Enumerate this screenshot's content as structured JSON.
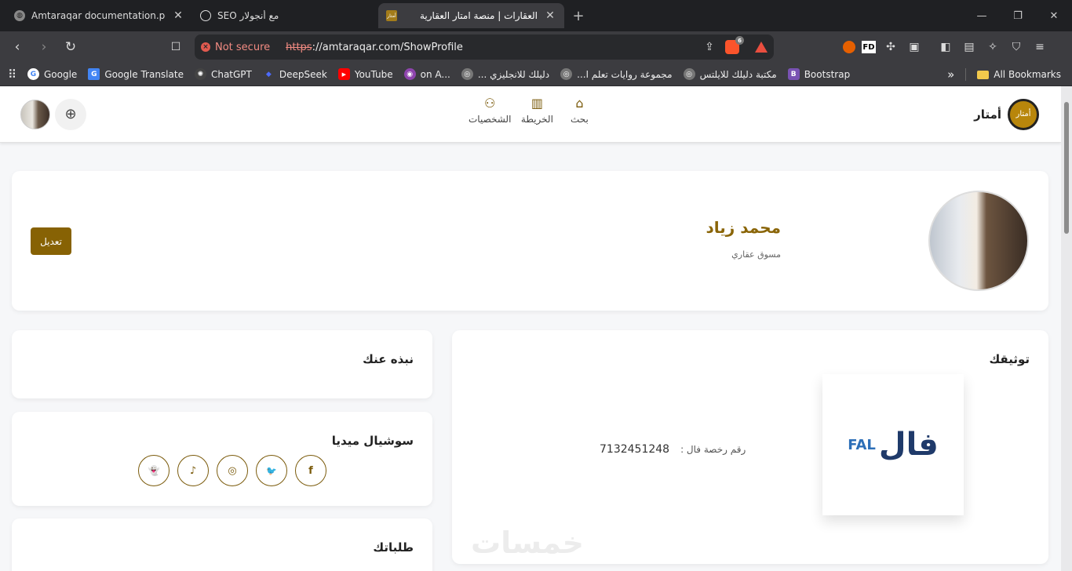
{
  "tabs": [
    {
      "title": "Amtaraqar documentation.pdf",
      "icon": "globe-icon"
    },
    {
      "title": "مع أنجولار SEO",
      "icon": "chatgpt-icon"
    },
    {
      "title": "العقارات | منصة امتار العقارية",
      "icon": "amtar-icon",
      "active": true
    }
  ],
  "address": {
    "security": "Not secure",
    "scheme": "https",
    "rest": "://amtaraqar.com/ShowProfile"
  },
  "brave_badge": "6",
  "bookmarks": {
    "items": [
      {
        "label": "Google",
        "icon": "G",
        "color": "#ffffff"
      },
      {
        "label": "Google Translate",
        "icon": "G",
        "color": "#4285f4"
      },
      {
        "label": "ChatGPT",
        "icon": "✺",
        "color": "#444444"
      },
      {
        "label": "DeepSeek",
        "icon": "◆",
        "color": "#4d6bfe"
      },
      {
        "label": "YouTube",
        "icon": "▶",
        "color": "#ff0000"
      },
      {
        "label": "on A...",
        "icon": "◉",
        "color": "#8e44ad"
      },
      {
        "label": "دليلك للانجليزي ...",
        "icon": "◎",
        "color": "#777777"
      },
      {
        "label": "مجموعة روايات تعلم ا...",
        "icon": "◎",
        "color": "#777777"
      },
      {
        "label": "مكتبة دليلك للايلتس",
        "icon": "◎",
        "color": "#777777"
      },
      {
        "label": "Bootstrap",
        "icon": "B",
        "color": "#7952b3"
      }
    ],
    "more": "»",
    "all": "All Bookmarks"
  },
  "site": {
    "brand": "أمتار",
    "logo_text": "أمتار",
    "nav": [
      {
        "label": "الشخصيات",
        "icon": "people-icon",
        "glyph": "⚇"
      },
      {
        "label": "الخريطة",
        "icon": "map-icon",
        "glyph": "▥"
      },
      {
        "label": "بحث",
        "icon": "home-icon",
        "glyph": "⌂"
      }
    ],
    "plus": "⊕"
  },
  "profile": {
    "name": "محمد زياد",
    "role": "مسوق عقاري",
    "edit_label": "تعديل"
  },
  "verification": {
    "title": "توثيقك",
    "fal_en": "FAL",
    "fal_ar": "فال",
    "license_label": "رقم رخصة فال :",
    "license_number": "7132451248"
  },
  "about": {
    "title": "نبذه عنك"
  },
  "social": {
    "title": "سوشيال ميديا",
    "icons": [
      {
        "name": "snapchat-icon",
        "glyph": "👻"
      },
      {
        "name": "tiktok-icon",
        "glyph": "♪"
      },
      {
        "name": "instagram-icon",
        "glyph": "◎"
      },
      {
        "name": "twitter-icon",
        "glyph": "🐦"
      },
      {
        "name": "facebook-icon",
        "glyph": "f"
      }
    ]
  },
  "orders": {
    "title": "طلباتك"
  },
  "watermark": "خمسات"
}
